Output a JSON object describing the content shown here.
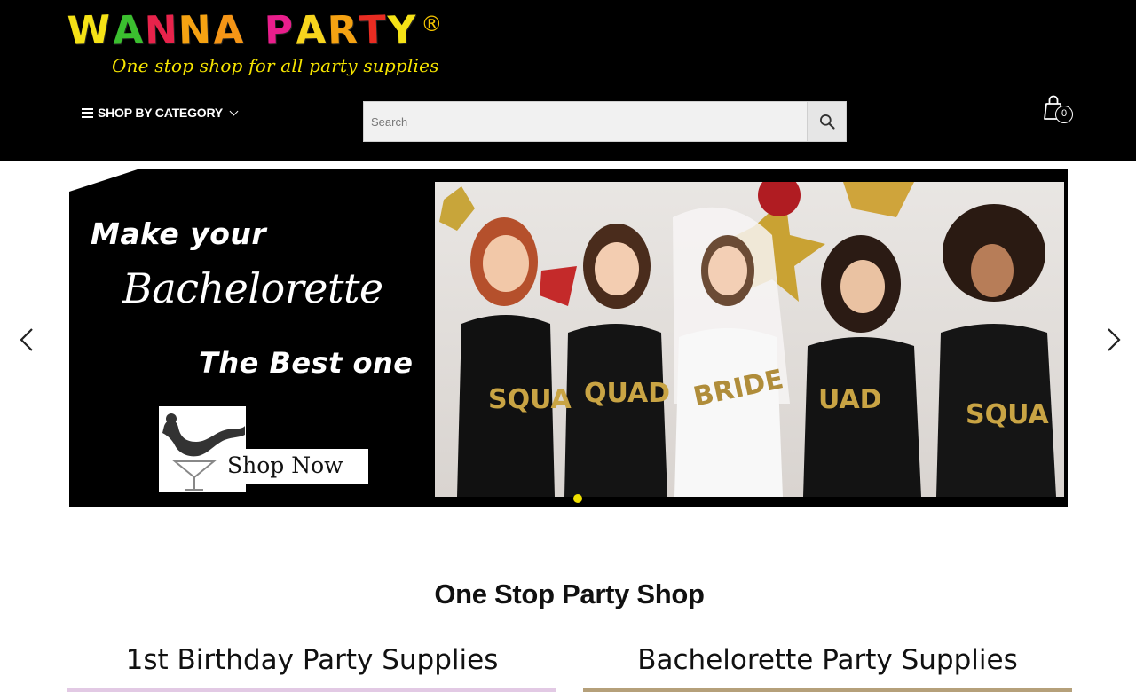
{
  "header": {
    "logo": {
      "letters": [
        {
          "char": "W",
          "color": "#f5e216"
        },
        {
          "char": "A",
          "color": "#3bbf2f"
        },
        {
          "char": "N",
          "color": "#e8234b"
        },
        {
          "char": "N",
          "color": "#f5a212"
        },
        {
          "char": "A",
          "color": "#f59516"
        },
        {
          "char": "P",
          "color": "#e91e8c"
        },
        {
          "char": "A",
          "color": "#f7d51d"
        },
        {
          "char": "R",
          "color": "#f5a212"
        },
        {
          "char": "T",
          "color": "#e82c22"
        },
        {
          "char": "Y",
          "color": "#f5e216"
        }
      ],
      "registered": "®",
      "tagline": "One stop shop for all party supplies"
    },
    "shop_by_category_label": "SHOP BY CATEGORY",
    "search": {
      "placeholder": "Search"
    },
    "cart": {
      "count": "0"
    }
  },
  "slider": {
    "line1": "Make your",
    "line2": "Bachelorette",
    "line3": "The Best one",
    "cta_label": "Shop Now",
    "photo_shirts": [
      "SQUA",
      "QUAD",
      "BRIDE",
      "UAD",
      "SQUA"
    ],
    "active_slide": 1,
    "colors": {
      "dot_active": "#f0e000"
    }
  },
  "main": {
    "section_title": "One Stop Party Shop",
    "categories": [
      {
        "label": "1st Birthday Party Supplies",
        "accent": "#e2c9e4"
      },
      {
        "label": "Bachelorette Party Supplies",
        "accent": "#b5a07a"
      }
    ]
  }
}
